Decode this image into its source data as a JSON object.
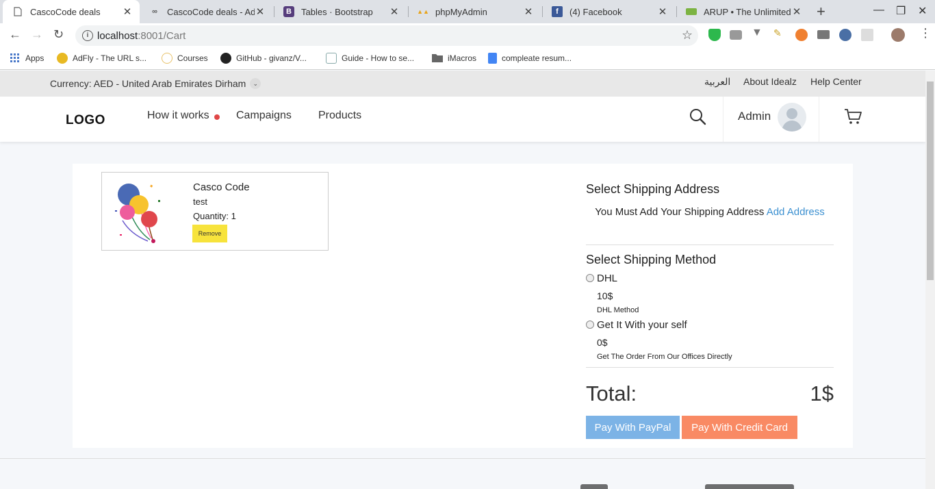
{
  "browser": {
    "tabs": [
      {
        "title": "CascoCode deals",
        "favicon": "page-icon",
        "active": true
      },
      {
        "title": "CascoCode deals - Adm",
        "favicon": "infinity-icon"
      },
      {
        "title": "Tables · Bootstrap",
        "favicon": "bootstrap-icon"
      },
      {
        "title": "phpMyAdmin",
        "favicon": "phpmyadmin-icon"
      },
      {
        "title": "(4) Facebook",
        "favicon": "facebook-icon"
      },
      {
        "title": "ARUP • The Unlimited",
        "favicon": "arup-icon"
      }
    ],
    "url_host": "localhost",
    "url_rest": ":8001/Cart",
    "bookmarks": [
      "Apps",
      "AdFly - The URL s...",
      "Courses",
      "GitHub - givanz/V...",
      "Guide - How to se...",
      "iMacros",
      "compleate resum..."
    ]
  },
  "topbar": {
    "currency": "Currency: AED - United Arab Emirates Dirham",
    "links": [
      "العربية",
      "About Idealz",
      "Help Center"
    ]
  },
  "header": {
    "logo": "LOGO",
    "nav": [
      "How it works",
      "Campaigns",
      "Products"
    ],
    "user": "Admin"
  },
  "cart_item": {
    "name": "Casco Code",
    "desc": "test",
    "quantity": "Quantity: 1",
    "remove_label": "Remove"
  },
  "shipping": {
    "address_title": "Select Shipping Address",
    "address_note": "You Must Add Your Shipping Address",
    "add_address_label": "Add Address",
    "method_title": "Select Shipping Method",
    "methods": [
      {
        "name": "DHL",
        "price": "10$",
        "desc": "DHL Method"
      },
      {
        "name": "Get It With your self",
        "price": "0$",
        "desc": "Get The Order From Our Offices Directly"
      }
    ]
  },
  "total": {
    "label": "Total:",
    "value": "1$"
  },
  "pay": {
    "paypal": "Pay With PayPal",
    "card": "Pay With Credit Card"
  },
  "colors": {
    "accent": "#3a8fd0",
    "remove": "#f7e33c",
    "paypal": "#7cb3e6",
    "card": "#f98a64",
    "dot": "#e04646"
  }
}
